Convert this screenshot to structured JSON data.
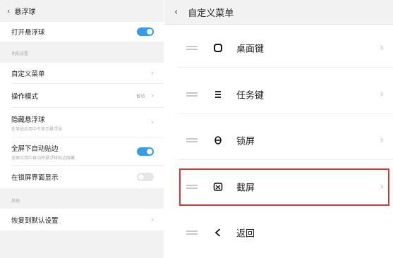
{
  "left_panel": {
    "header": {
      "back_icon": "chevron-left-icon",
      "title": "悬浮球"
    },
    "toggle_row": {
      "label": "打开悬浮球",
      "toggle_state": "on"
    },
    "section_functions": "功能设置",
    "rows": [
      {
        "label": "自定义菜单",
        "icon": "chevron-right-icon"
      },
      {
        "label": "操作模式",
        "value": "省动",
        "icon": "chevron-right-icon"
      },
      {
        "label": "隐藏悬浮球",
        "subtitle": "在某些应用中不显示悬浮球",
        "icon": "chevron-right-icon"
      }
    ],
    "edge_row": {
      "label": "全屏下自动贴边",
      "subtitle": "全屏应用中自动将悬浮球贴边隐藏",
      "toggle_state": "on"
    },
    "lockscreen_row": {
      "label": "在锁屏界面显示",
      "toggle_state": "off"
    },
    "section_other": "其他",
    "reset_row": {
      "label": "恢复到默认设置",
      "icon": "chevron-right-icon"
    }
  },
  "right_panel": {
    "header": {
      "back_icon": "chevron-left-icon",
      "title": "自定义菜单"
    },
    "menu_items": [
      {
        "label": "桌面键",
        "icon": "home-rounded-square-icon"
      },
      {
        "label": "任务键",
        "icon": "menu-lines-icon"
      },
      {
        "label": "锁屏",
        "icon": "lock-icon"
      },
      {
        "label": "截屏",
        "icon": "screenshot-icon",
        "highlighted": true
      },
      {
        "label": "返回",
        "icon": "back-arrow-icon"
      }
    ],
    "highlight_color": "#d8373a"
  },
  "colors": {
    "accent": "#2e9df2",
    "background": "#f2f2f2"
  }
}
